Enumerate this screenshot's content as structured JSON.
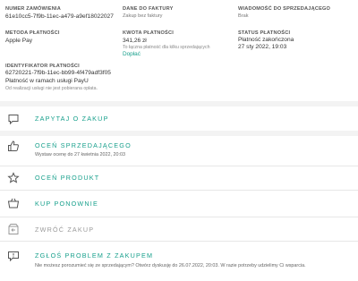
{
  "details": {
    "order_number": {
      "label": "NUMER ZAMÓWIENIA",
      "value": "61e10cc5-7f9b-11ec-a479-a9ef18022027"
    },
    "invoice": {
      "label": "DANE DO FAKTURY",
      "value": "Zakup bez faktury"
    },
    "seller_message": {
      "label": "WIADOMOŚĆ DO SPRZEDAJĄCEGO",
      "value": "Brak"
    },
    "payment_method": {
      "label": "METODA PŁATNOŚCI",
      "value": "Apple Pay"
    },
    "payment_amount": {
      "label": "KWOTA PŁATNOŚCI",
      "value": "341,26 zł",
      "note": "To łączna płatność dla kilku sprzedających",
      "link": "Dopłać"
    },
    "payment_status": {
      "label": "STATUS PŁATNOŚCI",
      "value": "Płatność zakończona",
      "date": "27 sty 2022, 19:03"
    },
    "payment_id": {
      "label": "IDENTYFIKATOR PŁATNOŚCI",
      "value": "62720221-7f9b-11ec-bb99-4f479adf3f05",
      "service": "Płatność w ramach usługi PayU",
      "note": "Od realizacji usługi nie jest pobierana opłata."
    }
  },
  "actions": {
    "ask": {
      "label": "ZAPYTAJ O ZAKUP",
      "icon": "chat-bubble-icon"
    },
    "rate_seller": {
      "label": "OCEŃ SPRZEDAJĄCEGO",
      "sub": "Wystaw ocenę do 27 kwietnia 2022, 20:03",
      "icon": "thumbs-up-icon"
    },
    "rate_product": {
      "label": "OCEŃ PRODUKT",
      "icon": "star-icon"
    },
    "buy_again": {
      "label": "KUP PONOWNIE",
      "icon": "basket-icon"
    },
    "return": {
      "label": "ZWRÓĆ ZAKUP",
      "icon": "return-box-icon"
    },
    "report": {
      "label": "ZGŁOŚ PROBLEM Z ZAKUPEM",
      "sub": "Nie możesz porozumieć się ze sprzedającym? Otwórz dyskusję do 26.07.2022, 20:03. W razie potrzeby udzielimy Ci wsparcia.",
      "icon": "warning-chat-icon"
    }
  },
  "colors": {
    "accent": "#18a08c",
    "disabled": "#9a9a9a",
    "band": "#f3f3f3",
    "separator": "#e7e7e7"
  }
}
